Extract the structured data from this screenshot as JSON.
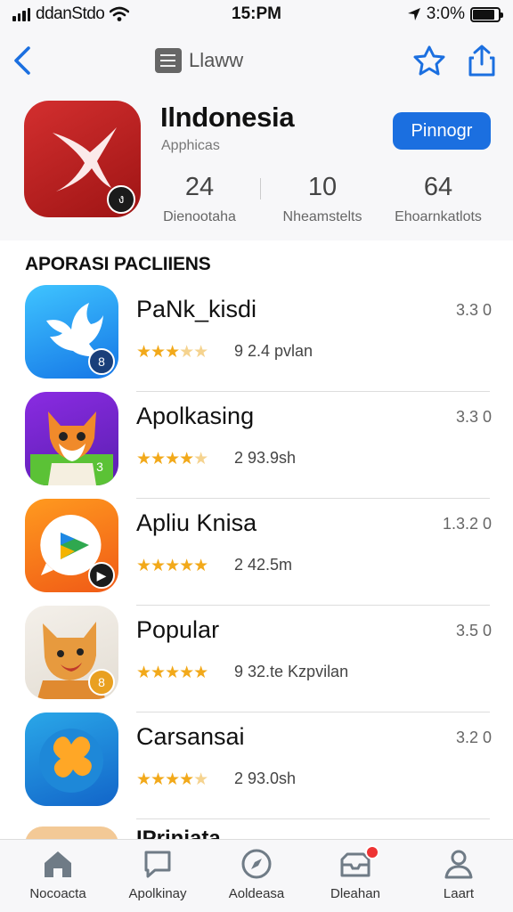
{
  "status_bar": {
    "carrier": "ddanStdo",
    "time": "15:PM",
    "battery": "3:0%"
  },
  "nav": {
    "back_label": "Back",
    "title": "Llaww",
    "star_label": "Favorite",
    "share_label": "Share"
  },
  "app": {
    "name": "Ilndonesia",
    "subtitle": "Apphicas",
    "get_label": "Pinnogr",
    "icon_badge": "ง",
    "stats": [
      {
        "value": "24",
        "label": "Dienootaha"
      },
      {
        "value": "10",
        "label": "Nheamstelts"
      },
      {
        "value": "64",
        "label": "Ehoarnkatlots"
      }
    ]
  },
  "section_title": "APORASI PACLIIENS",
  "apps": [
    {
      "title": "PaNk_kisdi",
      "rating": 3.5,
      "meta": "9  2.4 pvlan",
      "version": "3.3 0",
      "badge": "8"
    },
    {
      "title": "Apolkasing",
      "rating": 4.5,
      "meta": "2  93.9sh",
      "version": "3.3 0",
      "badge": "3"
    },
    {
      "title": "Apliu Knisa",
      "rating": 5,
      "meta": "2  42.5m",
      "version": "1.3.2 0",
      "badge": "▶"
    },
    {
      "title": "Popular",
      "rating": 5,
      "meta": "9  32.te Kzpvilan",
      "version": "3.5 0",
      "badge": "8"
    },
    {
      "title": "Carsansai",
      "rating": 4.5,
      "meta": "2  93.0sh",
      "version": "3.2 0",
      "badge": ""
    }
  ],
  "peek_title": "IPriniata",
  "colors": {
    "accent": "#1b6fe0",
    "star": "#f2a91a",
    "app_red": "#c62828"
  },
  "tabs": [
    {
      "label": "Nocoacta",
      "icon": "home-icon"
    },
    {
      "label": "Apolkinay",
      "icon": "message-icon"
    },
    {
      "label": "Aoldeasa",
      "icon": "compass-icon"
    },
    {
      "label": "Dleahan",
      "icon": "inbox-icon"
    },
    {
      "label": "Laart",
      "icon": "person-icon"
    }
  ]
}
